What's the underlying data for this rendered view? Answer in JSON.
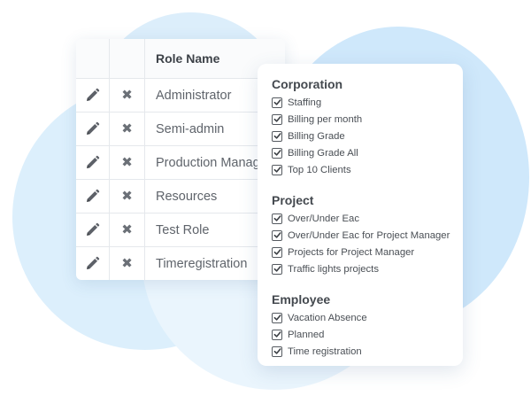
{
  "colors": {
    "background": "#ffffff",
    "blob_light": "#eaf5fd",
    "blob_blue": "#cfe8fb",
    "border": "#e5e8ec",
    "text": "#5f646b",
    "heading": "#3d4248"
  },
  "roles_table": {
    "header": {
      "edit": "",
      "delete": "",
      "name": "Role Name"
    },
    "rows": [
      {
        "name": "Administrator",
        "edit_icon": "pencil-icon",
        "delete_icon": "x-icon"
      },
      {
        "name": "Semi-admin",
        "edit_icon": "pencil-icon",
        "delete_icon": "x-icon"
      },
      {
        "name": "Production Manager",
        "edit_icon": "pencil-icon",
        "delete_icon": "x-icon"
      },
      {
        "name": "Resources",
        "edit_icon": "pencil-icon",
        "delete_icon": "x-icon"
      },
      {
        "name": "Test Role",
        "edit_icon": "pencil-icon",
        "delete_icon": "x-icon"
      },
      {
        "name": "Timeregistration",
        "edit_icon": "pencil-icon",
        "delete_icon": "x-icon"
      }
    ]
  },
  "permissions": {
    "groups": [
      {
        "title": "Corporation",
        "items": [
          {
            "label": "Staffing",
            "checked": true
          },
          {
            "label": "Billing per month",
            "checked": true
          },
          {
            "label": "Billing Grade",
            "checked": true
          },
          {
            "label": "Billing Grade All",
            "checked": true
          },
          {
            "label": "Top 10 Clients",
            "checked": true
          }
        ]
      },
      {
        "title": "Project",
        "items": [
          {
            "label": "Over/Under Eac",
            "checked": true
          },
          {
            "label": "Over/Under Eac for Project Manager",
            "checked": true
          },
          {
            "label": "Projects for Project Manager",
            "checked": true
          },
          {
            "label": "Traffic lights projects",
            "checked": true
          }
        ]
      },
      {
        "title": "Employee",
        "items": [
          {
            "label": "Vacation Absence",
            "checked": true
          },
          {
            "label": "Planned",
            "checked": true
          },
          {
            "label": "Time registration",
            "checked": true
          }
        ]
      }
    ]
  }
}
